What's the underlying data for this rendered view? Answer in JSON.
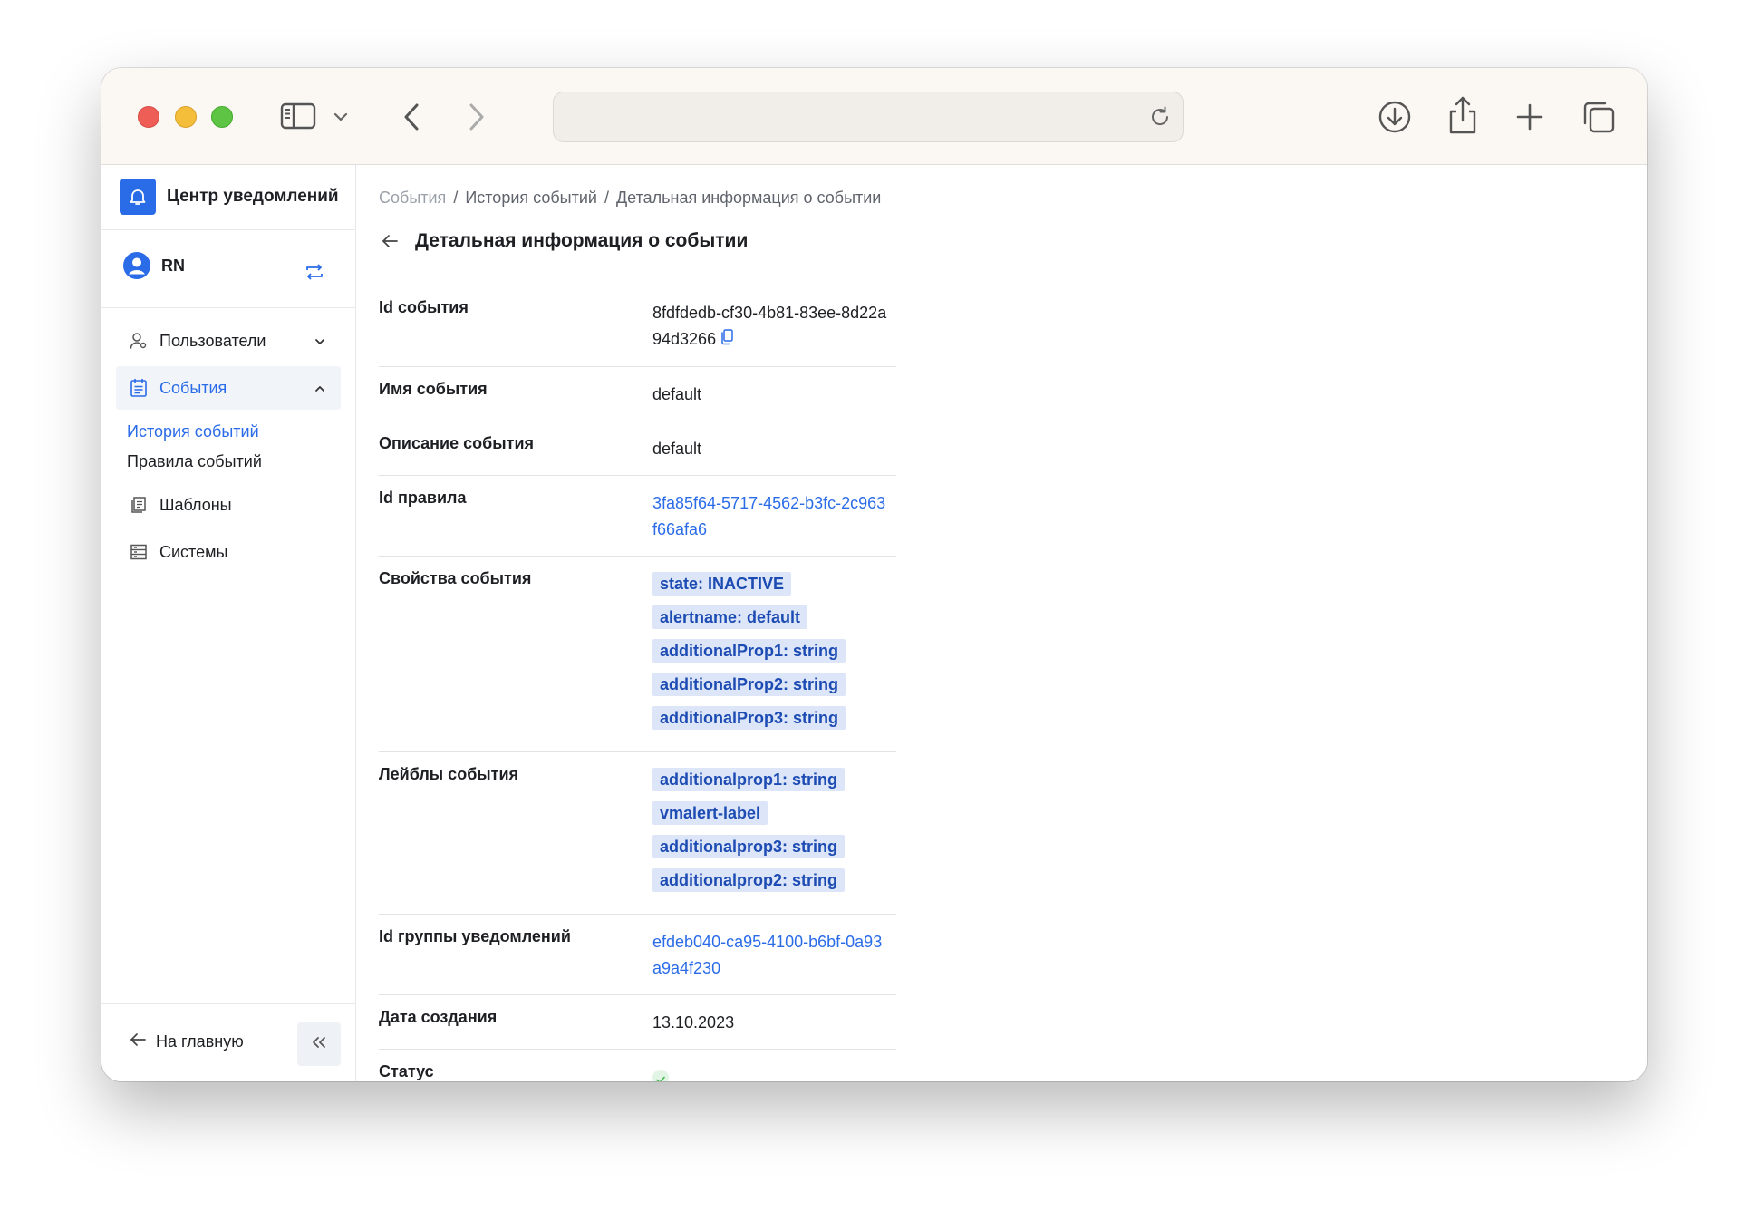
{
  "browser": {
    "url_value": "",
    "url_placeholder": ""
  },
  "sidebar": {
    "app_title": "Центр уведомлений",
    "user_name": "RN",
    "items": [
      {
        "label": "Пользователи",
        "icon": "users-gear-icon"
      },
      {
        "label": "События",
        "icon": "calendar-list-icon",
        "active": true
      },
      {
        "label": "Шаблоны",
        "icon": "templates-icon"
      },
      {
        "label": "Системы",
        "icon": "systems-icon"
      }
    ],
    "sub_items": [
      {
        "label": "История событий",
        "active": true
      },
      {
        "label": "Правила событий"
      }
    ],
    "home_label": "На главную"
  },
  "breadcrumb": [
    "События",
    "История событий",
    "Детальная информация о событии"
  ],
  "page_title": "Детальная информация о событии",
  "details": {
    "event_id": {
      "label": "Id события",
      "value": "8fdfdedb-cf30-4b81-83ee-8d22a94d3266"
    },
    "event_name": {
      "label": "Имя события",
      "value": "default"
    },
    "event_description": {
      "label": "Описание события",
      "value": "default"
    },
    "rule_id": {
      "label": "Id правила",
      "value": "3fa85f64-5717-4562-b3fc-2c963f66afa6"
    },
    "properties": {
      "label": "Свойства события",
      "tags": [
        "state: INACTIVE",
        "alertname: default",
        "additionalProp1: string",
        "additionalProp2: string",
        "additionalProp3: string"
      ]
    },
    "labels": {
      "label": "Лейблы события",
      "tags": [
        "additionalprop1: string",
        "vmalert-label",
        "additionalprop3: string",
        "additionalprop2: string"
      ]
    },
    "group_id": {
      "label": "Id группы уведомлений",
      "value": "efdeb040-ca95-4100-b6bf-0a93a9a4f230"
    },
    "created": {
      "label": "Дата создания",
      "value": "13.10.2023"
    },
    "status": {
      "label": "Статус",
      "icon": "check-icon"
    }
  },
  "colors": {
    "accent": "#2a6be8",
    "tag_bg": "#dde6f8",
    "tag_text": "#1c4bb3",
    "status_ok": "#3fb950"
  }
}
